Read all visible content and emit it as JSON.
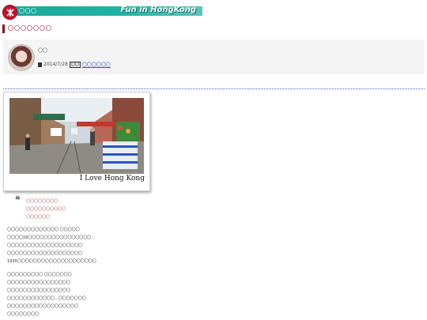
{
  "header": {
    "tag": "〇〇〇",
    "title": "Fun in HongKong",
    "accent": "#1aa89a",
    "logo_color": "#c8102e"
  },
  "page_title": "〇〇〇〇〇〇〇",
  "author": {
    "name": "〇〇",
    "date_icon": "calendar-icon",
    "date": "2014/7/28",
    "tag_icon_text": "〇〇",
    "tag_link": "〇〇〇〇〇〇"
  },
  "photo": {
    "caption": "I Love Hong Kong"
  },
  "quote": {
    "lines": [
      "〇〇〇〇〇〇〇〇",
      "〇〇〇〇〇〇〇〇〇〇",
      "〇〇〇〇〇〇"
    ]
  },
  "body": {
    "paragraph1": [
      "〇〇〇〇〇〇〇〇〇〇〇〇〇 〇〇〇〇〇",
      "〇〇〇〇16〇〇〇〇〇〇〇〇〇〇〇〇〇〇〇〇",
      "〇〇〇〇〇〇〇〇〇〇〇〇〇〇〇〇〇〇〇",
      "〇〇〇〇〇〇〇〇〇〇〇〇〇〇〇〇〇〇〇",
      "1930〇〇〇〇〇〇〇〇〇〇〇〇〇〇〇〇〇〇〇〇"
    ],
    "paragraph2": [
      "〇〇〇〇〇〇〇〇〇 〇〇〇〇〇〇〇",
      "〇〇〇〇〇〇〇〇〇〇〇〇〇〇〇〇",
      "〇〇〇〇〇〇〇〇〇〇〇〇〇〇〇〇",
      "〇〇〇〇〇〇〇〇〇〇〇〇...〇〇〇〇〇〇〇",
      "〇〇〇〇〇〇〇〇〇〇〇〇〇〇〇〇〇〇",
      "〇〇〇〇〇〇〇〇"
    ]
  }
}
